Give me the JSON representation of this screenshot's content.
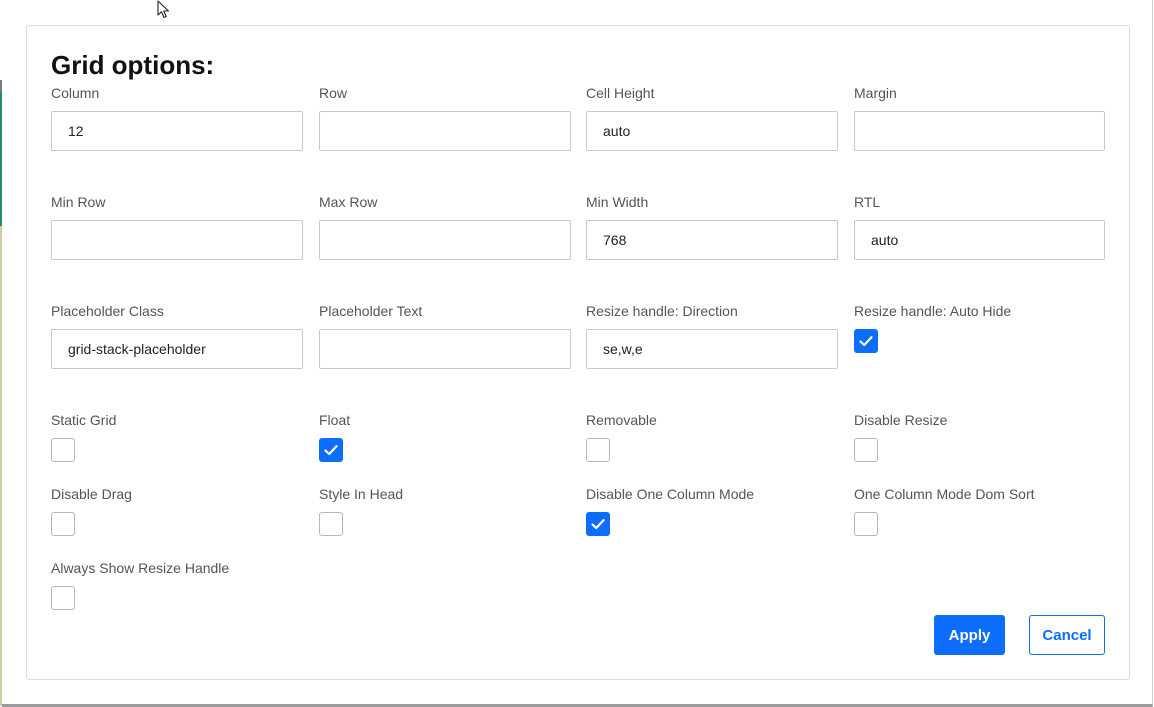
{
  "dialog": {
    "title": "Grid options:"
  },
  "fields": [
    {
      "id": "column",
      "label": "Column",
      "value": "12"
    },
    {
      "id": "row",
      "label": "Row",
      "value": ""
    },
    {
      "id": "cell_height",
      "label": "Cell Height",
      "value": "auto"
    },
    {
      "id": "margin",
      "label": "Margin",
      "value": ""
    },
    {
      "id": "min_row",
      "label": "Min Row",
      "value": ""
    },
    {
      "id": "max_row",
      "label": "Max Row",
      "value": ""
    },
    {
      "id": "min_width",
      "label": "Min Width",
      "value": "768"
    },
    {
      "id": "rtl",
      "label": "RTL",
      "value": "auto"
    },
    {
      "id": "placeholder_class",
      "label": "Placeholder Class",
      "value": "grid-stack-placeholder"
    },
    {
      "id": "placeholder_text",
      "label": "Placeholder Text",
      "value": ""
    },
    {
      "id": "resize_direction",
      "label": "Resize handle: Direction",
      "value": "se,w,e"
    }
  ],
  "checkboxes": [
    {
      "id": "resize_auto_hide",
      "label": "Resize handle: Auto Hide",
      "checked": true
    },
    {
      "id": "static_grid",
      "label": "Static Grid",
      "checked": false
    },
    {
      "id": "float",
      "label": "Float",
      "checked": true
    },
    {
      "id": "removable",
      "label": "Removable",
      "checked": false
    },
    {
      "id": "disable_resize",
      "label": "Disable Resize",
      "checked": false
    },
    {
      "id": "disable_drag",
      "label": "Disable Drag",
      "checked": false
    },
    {
      "id": "style_in_head",
      "label": "Style In Head",
      "checked": false
    },
    {
      "id": "disable_one_column_mode",
      "label": "Disable One Column Mode",
      "checked": true
    },
    {
      "id": "one_column_mode_dom_sort",
      "label": "One Column Mode Dom Sort",
      "checked": false
    },
    {
      "id": "always_show_resize_handle",
      "label": "Always Show Resize Handle",
      "checked": false
    }
  ],
  "actions": {
    "apply_label": "Apply",
    "cancel_label": "Cancel"
  },
  "colors": {
    "accent": "#0d6efd",
    "checkbox_border": "#b7b7b7",
    "label_text": "#555555"
  }
}
